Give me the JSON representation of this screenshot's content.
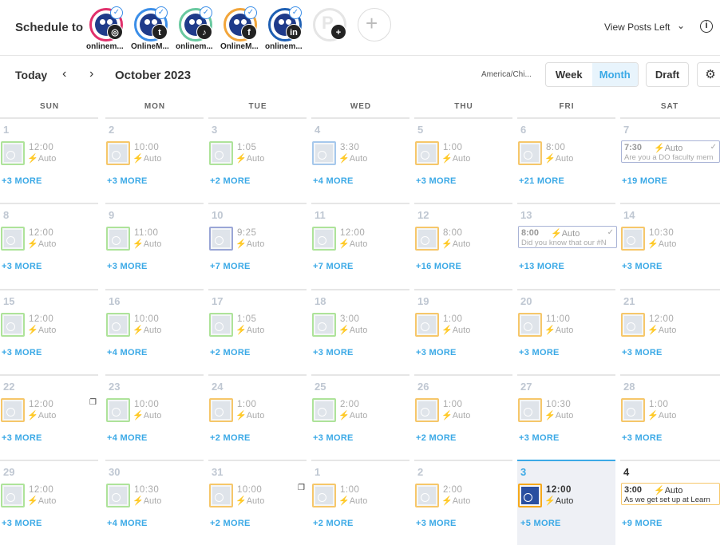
{
  "header": {
    "schedule_label": "Schedule to",
    "accounts": [
      {
        "name": "onlinem...",
        "network": "instagram-icon",
        "glyph": "◎",
        "ring": "#e1306c"
      },
      {
        "name": "OnlineM...",
        "network": "twitter-icon",
        "glyph": "t",
        "ring": "#3b8ee8"
      },
      {
        "name": "onlinem...",
        "network": "tiktok-icon",
        "glyph": "♪",
        "ring": "#69c9a0"
      },
      {
        "name": "OnlineM...",
        "network": "facebook-icon",
        "glyph": "f",
        "ring": "#f2a53a"
      },
      {
        "name": "onlinem...",
        "network": "linkedin-icon",
        "glyph": "in",
        "ring": "#1e5fb3"
      }
    ],
    "view_posts_label": "View Posts Left"
  },
  "toolbar": {
    "today_label": "Today",
    "month_title": "October 2023",
    "timezone": "America/Chi...",
    "view_options": [
      "Week",
      "Month"
    ],
    "active_view": "Month",
    "draft_label": "Draft"
  },
  "calendar": {
    "weekdays": [
      "SUN",
      "MON",
      "TUE",
      "WED",
      "THU",
      "FRI",
      "SAT"
    ],
    "weeks": [
      [
        {
          "day": "1",
          "time": "12:00",
          "mode": "Auto",
          "more": "+3 MORE",
          "thumb": "g"
        },
        {
          "day": "2",
          "time": "10:00",
          "mode": "Auto",
          "more": "+3 MORE",
          "thumb": "o"
        },
        {
          "day": "3",
          "time": "1:05",
          "mode": "Auto",
          "more": "+2 MORE",
          "thumb": "g"
        },
        {
          "day": "4",
          "time": "3:30",
          "mode": "Auto",
          "more": "+4 MORE",
          "thumb": "b"
        },
        {
          "day": "5",
          "time": "1:00",
          "mode": "Auto",
          "more": "+3 MORE",
          "thumb": "o"
        },
        {
          "day": "6",
          "time": "8:00",
          "mode": "Auto",
          "more": "+21 MORE",
          "thumb": "o"
        },
        {
          "day": "7",
          "time": "7:30",
          "mode": "Auto",
          "more": "+19 MORE",
          "text": "Are you a DO faculty mem",
          "style": "p"
        }
      ],
      [
        {
          "day": "8",
          "time": "12:00",
          "mode": "Auto",
          "more": "+3 MORE",
          "thumb": "g"
        },
        {
          "day": "9",
          "time": "11:00",
          "mode": "Auto",
          "more": "+3 MORE",
          "thumb": "g"
        },
        {
          "day": "10",
          "time": "9:25",
          "mode": "Auto",
          "more": "+7 MORE",
          "thumb": "p"
        },
        {
          "day": "11",
          "time": "12:00",
          "mode": "Auto",
          "more": "+7 MORE",
          "thumb": "g"
        },
        {
          "day": "12",
          "time": "8:00",
          "mode": "Auto",
          "more": "+16 MORE",
          "thumb": "o"
        },
        {
          "day": "13",
          "time": "8:00",
          "mode": "Auto",
          "more": "+13 MORE",
          "text": "Did you know that our #N",
          "style": "p"
        },
        {
          "day": "14",
          "time": "10:30",
          "mode": "Auto",
          "more": "+3 MORE",
          "thumb": "o"
        }
      ],
      [
        {
          "day": "15",
          "time": "12:00",
          "mode": "Auto",
          "more": "+3 MORE",
          "thumb": "g"
        },
        {
          "day": "16",
          "time": "10:00",
          "mode": "Auto",
          "more": "+4 MORE",
          "thumb": "g"
        },
        {
          "day": "17",
          "time": "1:05",
          "mode": "Auto",
          "more": "+2 MORE",
          "thumb": "g"
        },
        {
          "day": "18",
          "time": "3:00",
          "mode": "Auto",
          "more": "+3 MORE",
          "thumb": "g"
        },
        {
          "day": "19",
          "time": "1:00",
          "mode": "Auto",
          "more": "+3 MORE",
          "thumb": "o"
        },
        {
          "day": "20",
          "time": "11:00",
          "mode": "Auto",
          "more": "+3 MORE",
          "thumb": "o"
        },
        {
          "day": "21",
          "time": "12:00",
          "mode": "Auto",
          "more": "+3 MORE",
          "thumb": "o"
        }
      ],
      [
        {
          "day": "22",
          "time": "12:00",
          "mode": "Auto",
          "more": "+3 MORE",
          "thumb": "o",
          "copy": true
        },
        {
          "day": "23",
          "time": "10:00",
          "mode": "Auto",
          "more": "+4 MORE",
          "thumb": "g"
        },
        {
          "day": "24",
          "time": "1:00",
          "mode": "Auto",
          "more": "+2 MORE",
          "thumb": "o"
        },
        {
          "day": "25",
          "time": "2:00",
          "mode": "Auto",
          "more": "+3 MORE",
          "thumb": "g"
        },
        {
          "day": "26",
          "time": "1:00",
          "mode": "Auto",
          "more": "+2 MORE",
          "thumb": "o"
        },
        {
          "day": "27",
          "time": "10:30",
          "mode": "Auto",
          "more": "+3 MORE",
          "thumb": "o"
        },
        {
          "day": "28",
          "time": "1:00",
          "mode": "Auto",
          "more": "+3 MORE",
          "thumb": "o"
        }
      ],
      [
        {
          "day": "29",
          "time": "12:00",
          "mode": "Auto",
          "more": "+3 MORE",
          "thumb": "g"
        },
        {
          "day": "30",
          "time": "10:30",
          "mode": "Auto",
          "more": "+4 MORE",
          "thumb": "g"
        },
        {
          "day": "31",
          "time": "10:00",
          "mode": "Auto",
          "more": "+2 MORE",
          "thumb": "o",
          "copy": true
        },
        {
          "day": "1",
          "time": "1:00",
          "mode": "Auto",
          "more": "+2 MORE",
          "thumb": "o"
        },
        {
          "day": "2",
          "time": "2:00",
          "mode": "Auto",
          "more": "+3 MORE",
          "thumb": "o"
        },
        {
          "day": "3",
          "time": "12:00",
          "mode": "Auto",
          "more": "+5 MORE",
          "thumb": "o",
          "today": true
        },
        {
          "day": "4",
          "time": "3:00",
          "mode": "Auto",
          "more": "+9 MORE",
          "text": "As we get set up at Learn",
          "style": "o",
          "next": true
        }
      ]
    ]
  }
}
